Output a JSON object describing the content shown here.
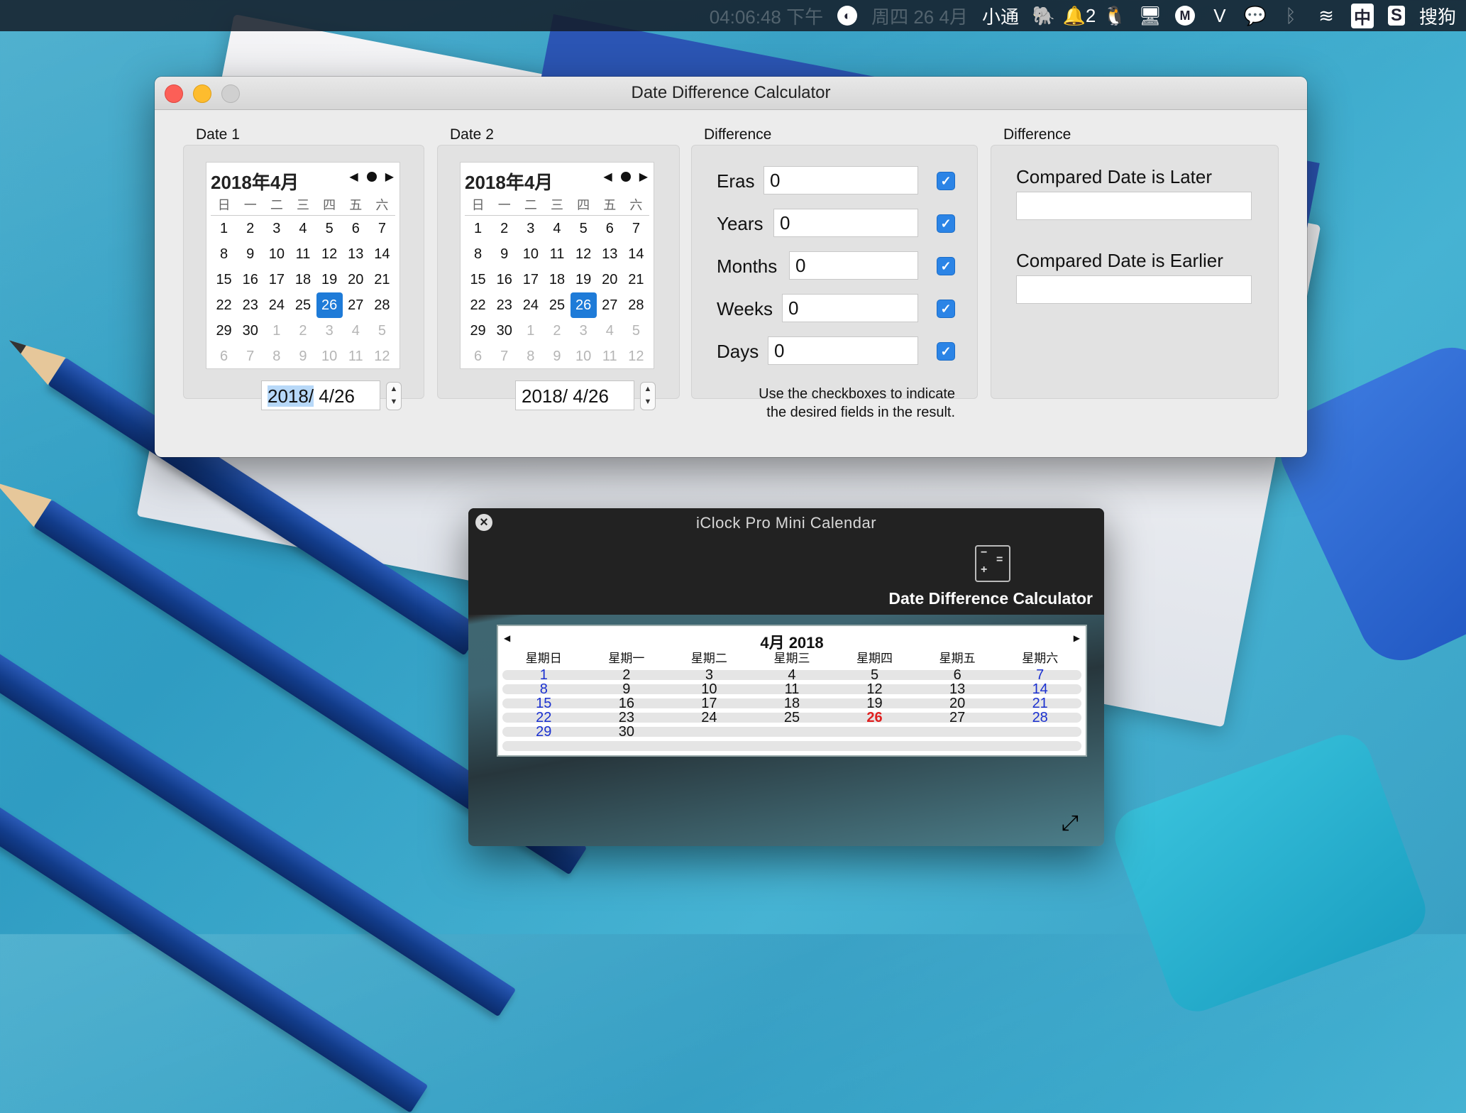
{
  "menubar": {
    "clock_text": "04:06:48 下午",
    "date_text": "周四 26 4月",
    "app_text": "小通",
    "badge_count": "2",
    "input_method": "中",
    "sogou_label": "搜狗"
  },
  "main_window": {
    "title": "Date Difference Calculator",
    "date1": {
      "label": "Date 1",
      "header": "2018年4月",
      "weekdays": [
        "日",
        "一",
        "二",
        "三",
        "四",
        "五",
        "六"
      ],
      "days": [
        [
          "",
          "1",
          "2",
          "3",
          "4",
          "5",
          "6",
          "7"
        ],
        [
          "8",
          "9",
          "10",
          "11",
          "12",
          "13",
          "14"
        ]
      ],
      "field_year": "2018/",
      "field_rest": " 4/26"
    },
    "date2": {
      "label": "Date 2",
      "header": "2018年4月",
      "field_year": "2018/",
      "field_rest": " 4/26"
    },
    "difference": {
      "label": "Difference",
      "eras_label": "Eras",
      "eras_value": "0",
      "years_label": "Years",
      "years_value": "0",
      "months_label": "Months",
      "months_value": "0",
      "weeks_label": "Weeks",
      "weeks_value": "0",
      "days_label": "Days",
      "days_value": "0",
      "hint_line1": "Use the checkboxes to indicate",
      "hint_line2": "the desired fields in the result."
    },
    "result": {
      "label": "Difference",
      "later_label": "Compared Date is Later",
      "later_value": "",
      "earlier_label": "Compared Date is Earlier",
      "earlier_value": ""
    }
  },
  "calendar_days": [
    "1",
    "2",
    "3",
    "4",
    "5",
    "6",
    "7",
    "8",
    "9",
    "10",
    "11",
    "12",
    "13",
    "14",
    "15",
    "16",
    "17",
    "18",
    "19",
    "20",
    "21",
    "22",
    "23",
    "24",
    "25",
    "26",
    "27",
    "28",
    "29",
    "30",
    "1",
    "2",
    "3",
    "4",
    "5",
    "6",
    "7",
    "8",
    "9",
    "10",
    "11",
    "12"
  ],
  "selected_day": "26",
  "iclock": {
    "title": "iClock Pro Mini Calendar",
    "tool_label": "Date Difference Calculator",
    "month_header": "4月 2018",
    "weekday_headers": [
      "星期日",
      "星期一",
      "星期二",
      "星期三",
      "星期四",
      "星期五",
      "星期六"
    ],
    "weeks": [
      [
        "1",
        "2",
        "3",
        "4",
        "5",
        "6",
        "7"
      ],
      [
        "8",
        "9",
        "10",
        "11",
        "12",
        "13",
        "14"
      ],
      [
        "15",
        "16",
        "17",
        "18",
        "19",
        "20",
        "21"
      ],
      [
        "22",
        "23",
        "24",
        "25",
        "26",
        "27",
        "28"
      ],
      [
        "29",
        "30",
        "",
        "",
        "",
        "",
        ""
      ]
    ],
    "today": "26",
    "accent_blue": "#1a30d0",
    "accent_red": "#e02020"
  },
  "colors": {
    "selection_blue": "#1e7bd8",
    "checkbox_blue": "#2b84e6"
  }
}
